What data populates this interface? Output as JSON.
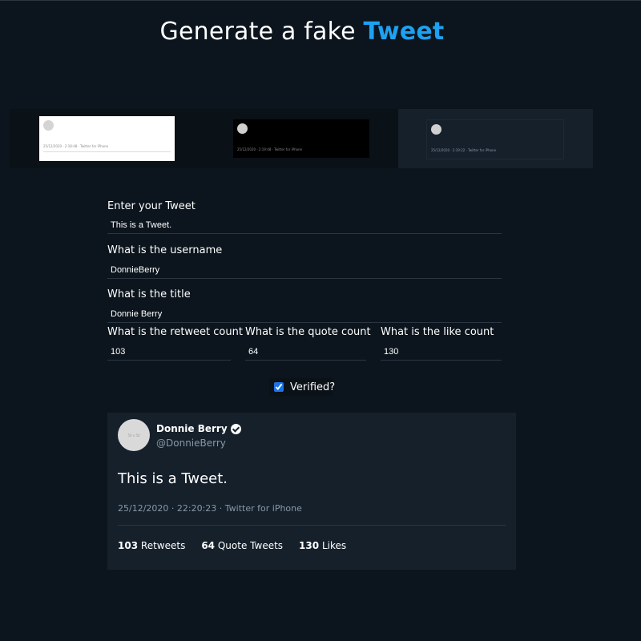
{
  "header": {
    "title_prefix": "Generate a fake",
    "title_accent": "Tweet",
    "accent_color": "#1da1f2"
  },
  "themes": [
    {
      "name": "light",
      "meta": "25/12/2020 · 2:18:48 · Twitter for iPhone"
    },
    {
      "name": "black",
      "meta": "25/12/2020 · 2:19:48 · Twitter for iPhone"
    },
    {
      "name": "dim",
      "meta": "25/12/2020 · 2:19:22 · Twitter for iPhone"
    }
  ],
  "form": {
    "tweet_label": "Enter your Tweet",
    "tweet_value": "This is a Tweet.",
    "username_label": "What is the username",
    "username_value": "DonnieBerry",
    "title_label": "What is the title",
    "title_value": "Donnie Berry",
    "retweet_label": "What is the retweet count",
    "retweet_value": "103",
    "quote_label": "What is the quote count",
    "quote_value": "64",
    "like_label": "What is the like count",
    "like_value": "130",
    "verified_label": "Verified?",
    "verified_checked": true
  },
  "preview": {
    "avatar_text": "50 x 50",
    "display_name": "Donnie Berry",
    "handle": "@DonnieBerry",
    "text": "This is a Tweet.",
    "meta": "25/12/2020 · 22:20:23 · Twitter for iPhone",
    "retweets_count": "103",
    "retweets_label": "Retweets",
    "quotes_count": "64",
    "quotes_label": "Quote Tweets",
    "likes_count": "130",
    "likes_label": "Likes"
  }
}
